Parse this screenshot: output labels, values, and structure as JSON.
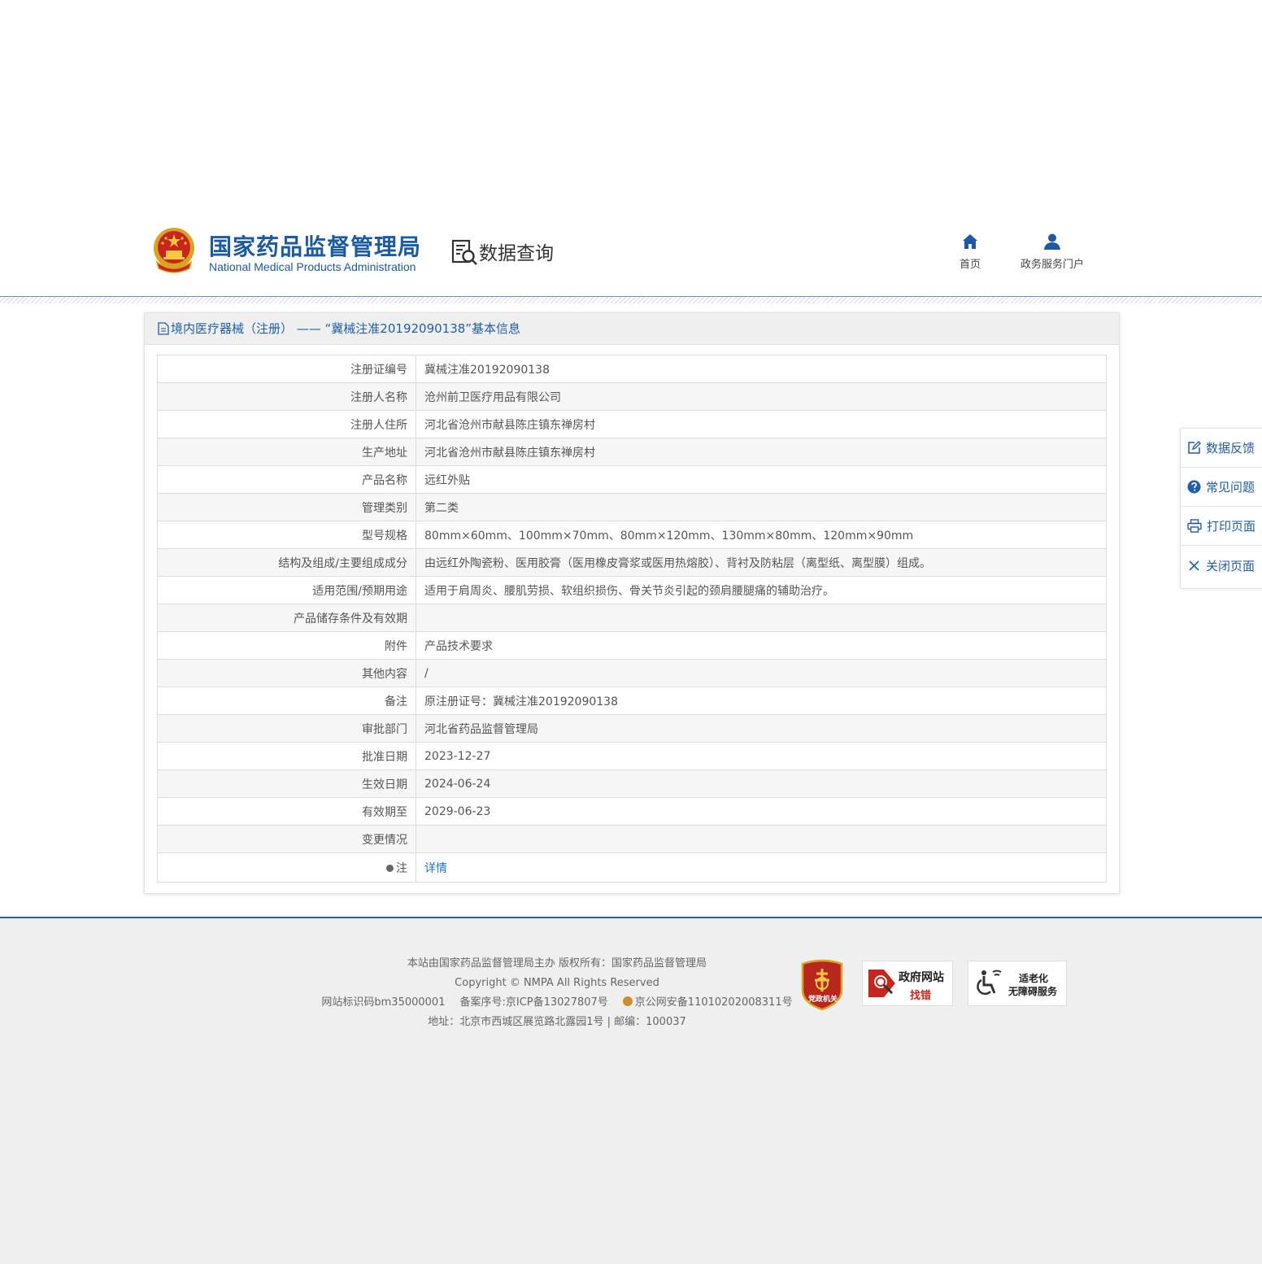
{
  "header": {
    "brand_cn": "国家药品监督管理局",
    "brand_en": "National Medical Products Administration",
    "section_title": "数据查询",
    "nav": [
      {
        "label": "首页",
        "icon": "home-icon"
      },
      {
        "label": "政务服务门户",
        "icon": "user-icon"
      }
    ]
  },
  "panel": {
    "title": "境内医疗器械（注册） —— “冀械注准20192090138”基本信息",
    "rows": [
      {
        "key": "注册证编号",
        "value": "冀械注准20192090138"
      },
      {
        "key": "注册人名称",
        "value": "沧州前卫医疗用品有限公司"
      },
      {
        "key": "注册人住所",
        "value": "河北省沧州市献县陈庄镇东禅房村"
      },
      {
        "key": "生产地址",
        "value": "河北省沧州市献县陈庄镇东禅房村"
      },
      {
        "key": "产品名称",
        "value": "远红外贴"
      },
      {
        "key": "管理类别",
        "value": "第二类"
      },
      {
        "key": "型号规格",
        "value": "80mm×60mm、100mm×70mm、80mm×120mm、130mm×80mm、120mm×90mm"
      },
      {
        "key": "结构及组成/主要组成成分",
        "value": "由远红外陶瓷粉、医用胶膏（医用橡皮膏浆或医用热熔胶）、背衬及防粘层（离型纸、离型膜）组成。"
      },
      {
        "key": "适用范围/预期用途",
        "value": "适用于肩周炎、腰肌劳损、软组织损伤、骨关节炎引起的颈肩腰腿痛的辅助治疗。"
      },
      {
        "key": "产品储存条件及有效期",
        "value": ""
      },
      {
        "key": "附件",
        "value": "产品技术要求"
      },
      {
        "key": "其他内容",
        "value": "/"
      },
      {
        "key": "备注",
        "value": "原注册证号：冀械注准20192090138"
      },
      {
        "key": "审批部门",
        "value": "河北省药品监督管理局"
      },
      {
        "key": "批准日期",
        "value": "2023-12-27"
      },
      {
        "key": "生效日期",
        "value": "2024-06-24"
      },
      {
        "key": "有效期至",
        "value": "2029-06-23"
      },
      {
        "key": "变更情况",
        "value": ""
      }
    ],
    "note_key": "注",
    "note_link": "详情"
  },
  "side_tools": [
    {
      "label": "数据反馈",
      "icon": "edit-icon"
    },
    {
      "label": "常见问题",
      "icon": "question-icon"
    },
    {
      "label": "打印页面",
      "icon": "print-icon"
    },
    {
      "label": "关闭页面",
      "icon": "close-icon"
    }
  ],
  "footer": {
    "line1": "本站由国家药品监督管理局主办 版权所有：国家药品监督管理局",
    "line2": "Copyright © NMPA All Rights Reserved",
    "site_id": "网站标识码bm35000001",
    "icp": "备案序号:京ICP备13027807号",
    "police": "京公网安备11010202008311号",
    "address": "地址：北京市西城区展览路北露园1号 | 邮编：100037",
    "badge_party": "党政机关",
    "badge_gov_1": "政府网站",
    "badge_gov_2": "找错",
    "badge_acc_1": "适老化",
    "badge_acc_2": "无障碍服务"
  },
  "colors": {
    "brand_blue": "#1a5aa6",
    "link_blue": "#1a73c8",
    "footer_bg": "#efefef"
  }
}
